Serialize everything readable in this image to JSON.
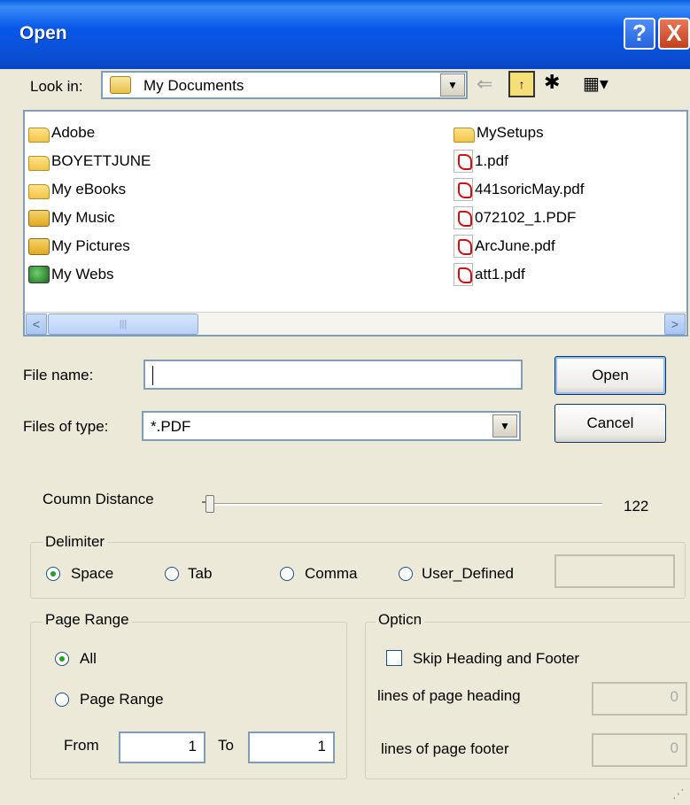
{
  "window": {
    "title": "Open"
  },
  "title_buttons": {
    "help": "?",
    "close": "X"
  },
  "look_in": {
    "label": "Look in:",
    "value": "My Documents"
  },
  "files": [
    {
      "name": "Adobe",
      "icon": "folder-icon"
    },
    {
      "name": "BOYETTJUNE",
      "icon": "folder-icon"
    },
    {
      "name": "My eBooks",
      "icon": "folder-icon"
    },
    {
      "name": "My Music",
      "icon": "music-folder-icon"
    },
    {
      "name": "My Pictures",
      "icon": "pictures-folder-icon"
    },
    {
      "name": "My Webs",
      "icon": "webs-folder-icon"
    },
    {
      "name": "MySetups",
      "icon": "folder-icon"
    },
    {
      "name": "1.pdf",
      "icon": "pdf-icon"
    },
    {
      "name": "441soricMay.pdf",
      "icon": "pdf-icon"
    },
    {
      "name": "072102_1.PDF",
      "icon": "pdf-icon"
    },
    {
      "name": "ArcJune.pdf",
      "icon": "pdf-icon"
    },
    {
      "name": "att1.pdf",
      "icon": "pdf-icon"
    }
  ],
  "scroll": {
    "left": "<",
    "right": ">",
    "grip": "|||"
  },
  "file_name": {
    "label": "File name:",
    "value": ""
  },
  "files_of_type": {
    "label": "Files of type:",
    "value": "*.PDF"
  },
  "buttons": {
    "open": "Open",
    "cancel": "Cancel"
  },
  "column_distance": {
    "label": "Coumn Distance",
    "value": "122"
  },
  "delimiter": {
    "legend": "Delimiter",
    "options": [
      "Space",
      "Tab",
      "Comma",
      "User_Defined"
    ],
    "selected": "Space",
    "user_defined_value": ""
  },
  "page_range": {
    "legend": "Page Range",
    "option_all": "All",
    "option_range": "Page Range",
    "selected": "All",
    "from_label": "From",
    "from_value": "1",
    "to_label": "To",
    "to_value": "1"
  },
  "option": {
    "legend": "Opticn",
    "skip_label": "Skip Heading and Footer",
    "skip_checked": false,
    "heading_label": "lines of page heading",
    "heading_value": "0",
    "footer_label": "lines of page footer",
    "footer_value": "0"
  },
  "colors": {
    "titlebar": "#0a5ee0",
    "dialog_bg": "#ece9d8",
    "button_border": "#003c74"
  }
}
